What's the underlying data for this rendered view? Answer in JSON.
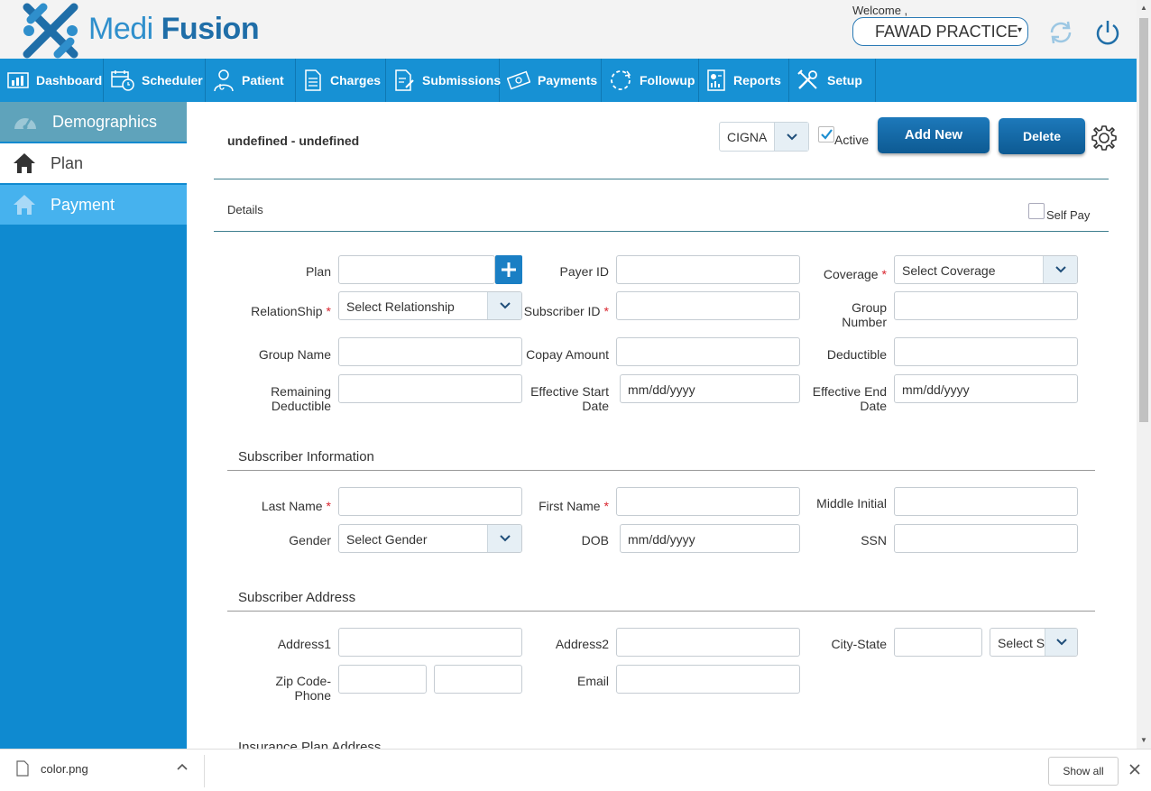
{
  "header": {
    "brand_part1": "Medi",
    "brand_part2": "Fusion",
    "welcome": "Welcome ,",
    "practice": "FAWAD PRACTICE",
    "caret": "▾"
  },
  "nav": [
    {
      "label": "Dashboard",
      "icon": "dashboard-icon"
    },
    {
      "label": "Scheduler",
      "icon": "calendar-icon"
    },
    {
      "label": "Patient",
      "icon": "doctor-icon"
    },
    {
      "label": "Charges",
      "icon": "document-icon"
    },
    {
      "label": "Submissions",
      "icon": "document-edit-icon"
    },
    {
      "label": "Payments",
      "icon": "money-icon"
    },
    {
      "label": "Followup",
      "icon": "refresh-icon"
    },
    {
      "label": "Reports",
      "icon": "report-icon"
    },
    {
      "label": "Setup",
      "icon": "tools-icon"
    }
  ],
  "sidebar": [
    {
      "label": "Demographics",
      "icon": "speedometer-icon"
    },
    {
      "label": "Plan",
      "icon": "home-icon"
    },
    {
      "label": "Payment",
      "icon": "home-icon"
    }
  ],
  "toolbar": {
    "record_title": "undefined - undefined",
    "payer": "CIGNA",
    "active_label": "Active",
    "active_checked": true,
    "add_new": "Add New",
    "delete": "Delete"
  },
  "details": {
    "title": "Details",
    "self_pay": "Self Pay",
    "self_pay_checked": false
  },
  "form": {
    "plan": {
      "label": "Plan",
      "value": ""
    },
    "payer_id": {
      "label": "Payer ID",
      "value": ""
    },
    "coverage": {
      "label": "Coverage",
      "value": "Select Coverage"
    },
    "relationship": {
      "label": "RelationShip",
      "value": "Select Relationship"
    },
    "subscriber_id": {
      "label": "Subscriber ID",
      "value": ""
    },
    "group_number": {
      "label1": "Group",
      "label2": "Number",
      "value": ""
    },
    "group_name": {
      "label": "Group Name",
      "value": ""
    },
    "copay": {
      "label": "Copay Amount",
      "value": ""
    },
    "deductible": {
      "label": "Deductible",
      "value": ""
    },
    "remaining": {
      "label1": "Remaining",
      "label2": "Deductible",
      "value": ""
    },
    "eff_start": {
      "label1": "Effective Start",
      "label2": "Date",
      "value": "mm/dd/yyyy"
    },
    "eff_end": {
      "label1": "Effective End",
      "label2": "Date",
      "value": "mm/dd/yyyy"
    }
  },
  "subscriber_info": {
    "title": "Subscriber Information",
    "last_name": {
      "label": "Last Name",
      "value": ""
    },
    "first_name": {
      "label": "First Name",
      "value": ""
    },
    "middle_initial": {
      "label": "Middle Initial",
      "value": ""
    },
    "gender": {
      "label": "Gender",
      "value": "Select Gender"
    },
    "dob": {
      "label": "DOB",
      "value": "mm/dd/yyyy"
    },
    "ssn": {
      "label": "SSN",
      "value": ""
    }
  },
  "subscriber_address": {
    "title": "Subscriber Address",
    "address1": {
      "label": "Address1",
      "value": ""
    },
    "address2": {
      "label": "Address2",
      "value": ""
    },
    "city_state": {
      "label": "City-State",
      "city": "",
      "state": "Select State"
    },
    "zip_phone": {
      "label1": "Zip Code-",
      "label2": "Phone",
      "zip": "",
      "phone": ""
    },
    "email": {
      "label": "Email",
      "value": ""
    }
  },
  "insurance_plan_address": {
    "title": "Insurance Plan Address"
  },
  "download_bar": {
    "file_name": "color.png",
    "show_all": "Show all"
  },
  "colors": {
    "nav_bg": "#1791d4",
    "sidebar_bg": "#0f8ad0",
    "button_bg": "#1d79bb",
    "required": "#d9232d"
  }
}
